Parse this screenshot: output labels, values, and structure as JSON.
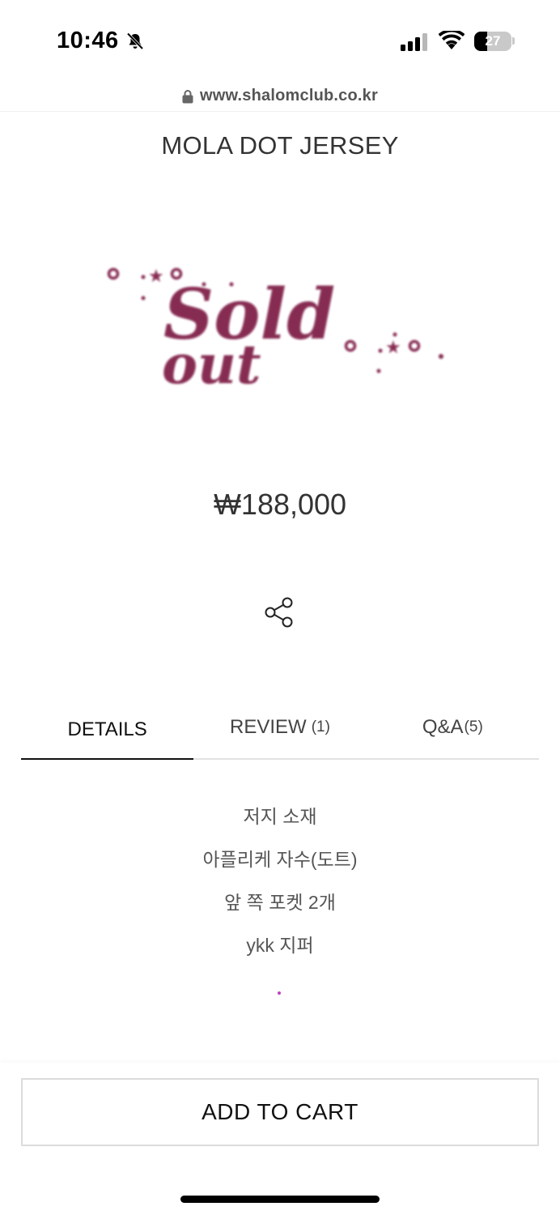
{
  "status_bar": {
    "time": "10:46",
    "battery": "27",
    "icons": [
      "bell-slash-icon",
      "signal-icon",
      "wifi-icon",
      "battery-icon"
    ]
  },
  "browser": {
    "url": "www.shalomclub.co.kr"
  },
  "product": {
    "title": "MOLA DOT JERSEY",
    "sold_out_word_1": "Sold",
    "sold_out_word_2": "out",
    "price": "₩188,000",
    "sold_out_color": "#7a1240"
  },
  "tabs": [
    {
      "label": "DETAILS",
      "count": "",
      "active": true
    },
    {
      "label": "REVIEW",
      "count": "(1)",
      "active": false
    },
    {
      "label": "Q&A",
      "count": "(5)",
      "active": false
    }
  ],
  "details": {
    "lines": [
      "저지 소재",
      "아플리케 자수(도트)",
      "앞 쪽 포켓 2개",
      "ykk 지퍼"
    ]
  },
  "actions": {
    "add_to_cart": "ADD TO CART"
  }
}
